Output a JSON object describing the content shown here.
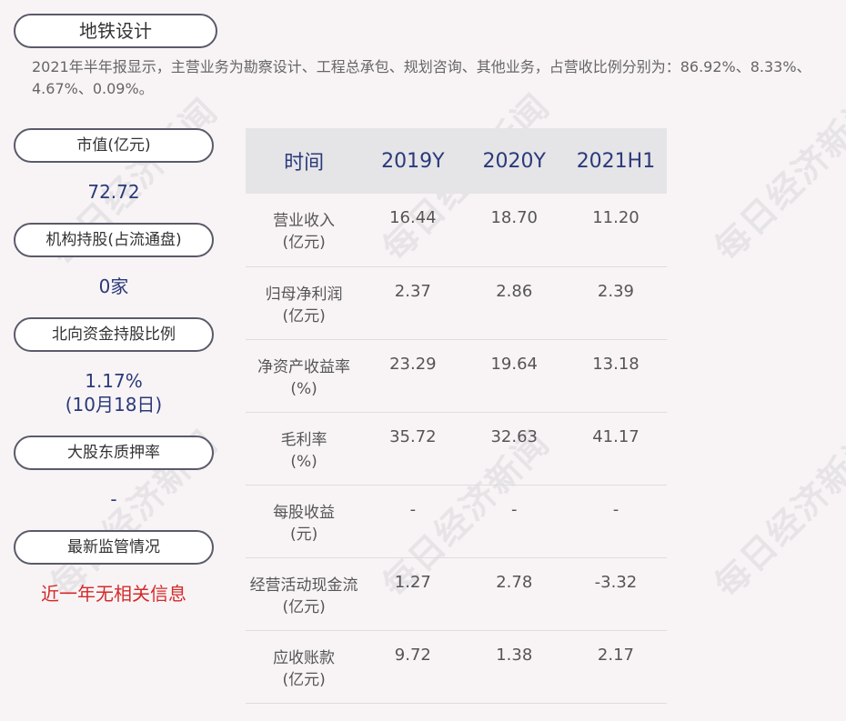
{
  "title": "地铁设计",
  "summary": "2021年半年报显示，主营业务为勘察设计、工程总承包、规划咨询、其他业务，占营收比例分别为：86.92%、8.33%、4.67%、0.09%。",
  "side": {
    "market_cap_label": "市值(亿元)",
    "market_cap_value": "72.72",
    "institution_label": "机构持股(占流通盘)",
    "institution_value": "0家",
    "northbound_label": "北向资金持股比例",
    "northbound_value": "1.17%",
    "northbound_date": "(10月18日)",
    "pledge_label": "大股东质押率",
    "pledge_value": "-",
    "regulation_label": "最新监管情况",
    "regulation_value": "近一年无相关信息"
  },
  "table": {
    "headers": [
      "时间",
      "2019Y",
      "2020Y",
      "2021H1"
    ],
    "rows": [
      {
        "label1": "营业收入",
        "label2": "(亿元)",
        "v": [
          "16.44",
          "18.70",
          "11.20"
        ]
      },
      {
        "label1": "归母净利润",
        "label2": "(亿元)",
        "v": [
          "2.37",
          "2.86",
          "2.39"
        ]
      },
      {
        "label1": "净资产收益率",
        "label2": "(%)",
        "v": [
          "23.29",
          "19.64",
          "13.18"
        ]
      },
      {
        "label1": "毛利率",
        "label2": "(%)",
        "v": [
          "35.72",
          "32.63",
          "41.17"
        ]
      },
      {
        "label1": "每股收益",
        "label2": "(元)",
        "v": [
          "-",
          "-",
          "-"
        ]
      },
      {
        "label1": "经营活动现金流",
        "label2": "(亿元)",
        "v": [
          "1.27",
          "2.78",
          "-3.32"
        ]
      },
      {
        "label1": "应收账款",
        "label2": "(亿元)",
        "v": [
          "9.72",
          "1.38",
          "2.17"
        ]
      }
    ]
  },
  "watermark": "每日经济新闻"
}
